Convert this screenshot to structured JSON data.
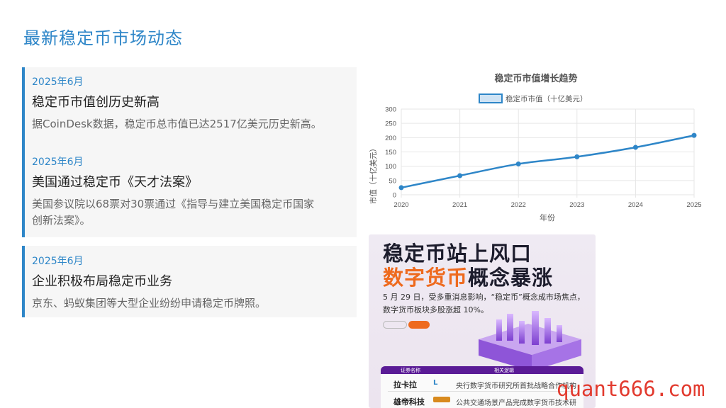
{
  "page": {
    "title": "最新稳定币市场动态"
  },
  "news": [
    {
      "date": "2025年6月",
      "title": "稳定币市值创历史新高",
      "desc": "据CoinDesk数据，稳定币总市值已达2517亿美元历史新高。"
    },
    {
      "date": "2025年6月",
      "title": "美国通过稳定币《天才法案》",
      "desc_line1": "美国参议院以68票对30票通过《指导与建立美国稳定币国家",
      "desc_line2": "创新法案》。"
    },
    {
      "date": "2025年6月",
      "title": "企业积极布局稳定币业务",
      "desc": "京东、蚂蚁集团等大型企业纷纷申请稳定币牌照。"
    }
  ],
  "chart_data": {
    "type": "line",
    "title": "稳定币市值增长趋势",
    "xlabel": "年份",
    "ylabel": "市值（十亿美元）",
    "categories": [
      "2020",
      "2021",
      "2022",
      "2023",
      "2024",
      "2025"
    ],
    "series": [
      {
        "name": "稳定币市值（十亿美元）",
        "values": [
          25,
          67,
          108,
          133,
          166,
          208
        ]
      }
    ],
    "ylim": [
      0,
      300
    ],
    "yticks": [
      0,
      50,
      100,
      150,
      200,
      250,
      300
    ],
    "grid": true,
    "legend": "top-center",
    "line_color": "#2e86c8"
  },
  "promo": {
    "headline1": "稳定币站上风口",
    "headline2_accent": "数字货币",
    "headline2_rest": "概念暴涨",
    "desc": "5 月 29 日，受多重消息影响，“稳定币”概念成市场焦点，数字货币板块多股涨超 10%。",
    "table_header_name": "证券名称",
    "table_header_logic": "相关逻辑",
    "rows": [
      {
        "name": "拉卡拉",
        "logo": "L",
        "logic": "央行数字货币研究所首批战略合作机构"
      },
      {
        "name": "雄帝科技",
        "logo": "",
        "logic": "公共交通场景产品完成数字货币技术研"
      }
    ]
  },
  "watermark": "quant666.com"
}
